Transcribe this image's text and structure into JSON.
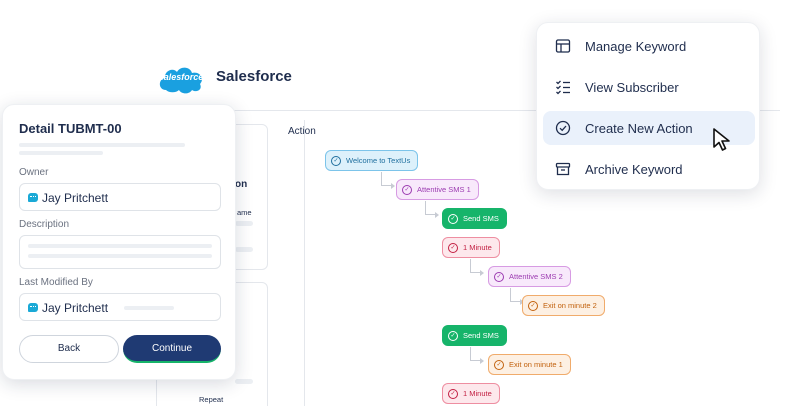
{
  "app": {
    "logo_text": "salesforce",
    "title": "Salesforce",
    "brand_color": "#1aa0e0"
  },
  "background_panel": {
    "ghost_heading_fragment": "on",
    "ghost_label_fragment": "ame",
    "ghost_repeat": "Repeat"
  },
  "flow": {
    "section_label": "Action",
    "nodes": [
      {
        "label": "Welcome to TextUs",
        "style": "blue",
        "icon": "check-circle-icon"
      },
      {
        "label": "Attentive SMS 1",
        "style": "purple",
        "icon": "check-circle-icon"
      },
      {
        "label": "Send SMS",
        "style": "green",
        "icon": "check-circle-icon"
      },
      {
        "label": "1 Minute",
        "style": "red",
        "icon": "check-circle-icon"
      },
      {
        "label": "Attentive SMS 2",
        "style": "purple",
        "icon": "check-circle-icon"
      },
      {
        "label": "Exit on minute 2",
        "style": "orange",
        "icon": "check-circle-icon"
      },
      {
        "label": "Send SMS",
        "style": "green",
        "icon": "check-circle-icon"
      },
      {
        "label": "Exit on minute 1",
        "style": "orange",
        "icon": "check-circle-icon"
      },
      {
        "label": "1 Minute",
        "style": "red",
        "icon": "check-circle-icon"
      }
    ]
  },
  "detail": {
    "title": "Detail TUBMT-00",
    "owner_label": "Owner",
    "owner_value": "Jay Pritchett",
    "description_label": "Description",
    "modified_label": "Last Modified By",
    "modified_value": "Jay Pritchett",
    "back_label": "Back",
    "continue_label": "Continue",
    "continue_color": "#1f3a73"
  },
  "menu": {
    "items": [
      {
        "label": "Manage Keyword",
        "icon": "table-icon",
        "active": false
      },
      {
        "label": "View Subscriber",
        "icon": "checklist-icon",
        "active": false
      },
      {
        "label": "Create New Action",
        "icon": "check-circle-icon",
        "active": true
      },
      {
        "label": "Archive Keyword",
        "icon": "archive-icon",
        "active": false
      }
    ]
  }
}
